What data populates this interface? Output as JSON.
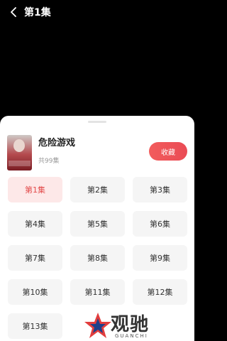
{
  "header": {
    "title": "第1集"
  },
  "drama": {
    "title": "危险游戏",
    "episode_count": "共99集",
    "favorite_label": "收藏"
  },
  "episodes": [
    "第1集",
    "第2集",
    "第3集",
    "第4集",
    "第5集",
    "第6集",
    "第7集",
    "第8集",
    "第9集",
    "第10集",
    "第11集",
    "第12集",
    "第13集"
  ],
  "active_episode": "第1集",
  "watermark": {
    "text": "观驰",
    "sub": "GUANCHI"
  },
  "colors": {
    "accent": "#ea4b55",
    "active_bg": "#fde8e8"
  }
}
